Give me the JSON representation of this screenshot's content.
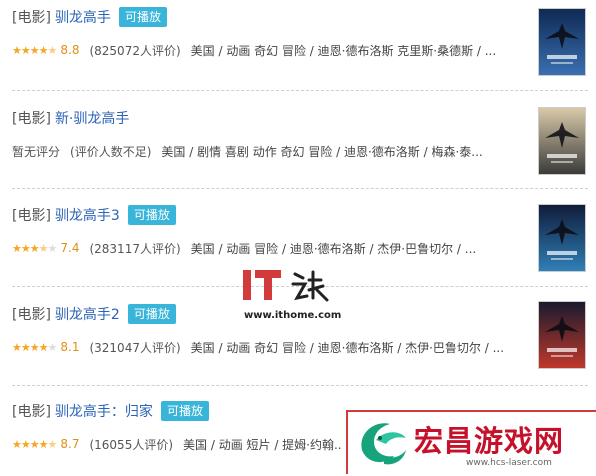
{
  "results": [
    {
      "category": "[电影]",
      "title": "驯龙高手",
      "badge": "可播放",
      "stars": 4.5,
      "score": "8.8",
      "ratings": "(825072人评价)",
      "info": "美国 / 动画 奇幻 冒险 / 迪恩·德布洛斯 克里斯·桑德斯 / ...",
      "poster_colors": [
        "#0f2a55",
        "#3a6fb0"
      ]
    },
    {
      "category": "[电影]",
      "title": "新·驯龙高手",
      "badge": "",
      "stars": 0,
      "no_score": "暂无评分",
      "ratings": "(评价人数不足)",
      "info": "美国 / 剧情 喜剧 动作 奇幻 冒险 / 迪恩·德布洛斯 / 梅森·泰...",
      "poster_colors": [
        "#d9c9a8",
        "#3b3b3b"
      ]
    },
    {
      "category": "[电影]",
      "title": "驯龙高手3",
      "badge": "可播放",
      "stars": 3.5,
      "score": "7.4",
      "ratings": "(283117人评价)",
      "info": "美国 / 动画 冒险 / 迪恩·德布洛斯 / 杰伊·巴鲁切尔 / ...",
      "poster_colors": [
        "#101c3a",
        "#2f7fb8"
      ]
    },
    {
      "category": "[电影]",
      "title": "驯龙高手2",
      "badge": "可播放",
      "stars": 4,
      "score": "8.1",
      "ratings": "(321047人评价)",
      "info": "美国 / 动画 奇幻 冒险 / 迪恩·德布洛斯 / 杰伊·巴鲁切尔 / ...",
      "poster_colors": [
        "#1a1a2e",
        "#c0392b"
      ]
    },
    {
      "category": "[电影]",
      "title": "驯龙高手：归家",
      "badge": "可播放",
      "stars": 4.5,
      "score": "8.7",
      "ratings": "(16055人评价)",
      "info": "美国 / 动画 短片 / 提姆·约翰...",
      "poster_colors": [
        "#1c2a4a",
        "#4a6fa5"
      ]
    }
  ],
  "watermark": {
    "logo_text": "IT",
    "url": "www.ithome.com",
    "color": "#d23b3b"
  },
  "banner": {
    "name": "宏昌游戏网",
    "url": "www.hcs-laser.com",
    "color": "#c5122a"
  }
}
